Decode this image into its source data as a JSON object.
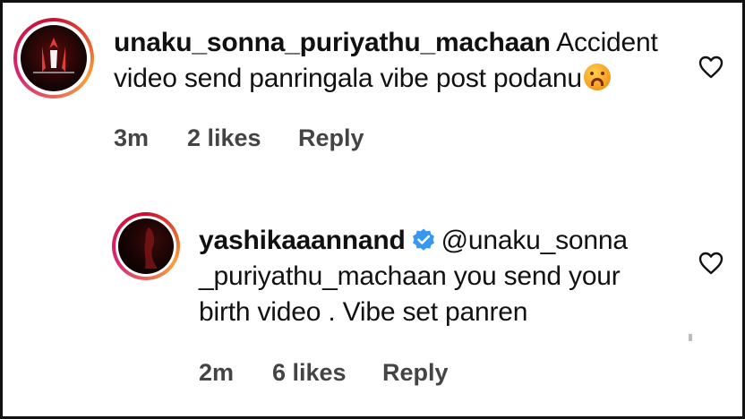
{
  "comments": [
    {
      "username": "unaku_sonna_puriyathu_machaan",
      "text_line1": "Accident",
      "text_line2": "video send panringala vibe post podanu",
      "emoji_icon": "crying-angry-face-emoji",
      "time": "3m",
      "likes": "2 likes",
      "reply": "Reply",
      "avatar_caption": "UNAKU SONNA PURIYATHU MACHAAN"
    },
    {
      "username": "yashikaaannand",
      "verified": true,
      "mention": "@unaku_sonna",
      "text_line2": "_puriyathu_machaan you send your",
      "text_line3": "birth video . Vibe set panren",
      "time": "2m",
      "likes": "6 likes",
      "reply": "Reply"
    }
  ],
  "colors": {
    "verified_badge": "#3897f0",
    "meta_text": "#444444",
    "ring": "#c8102e"
  }
}
